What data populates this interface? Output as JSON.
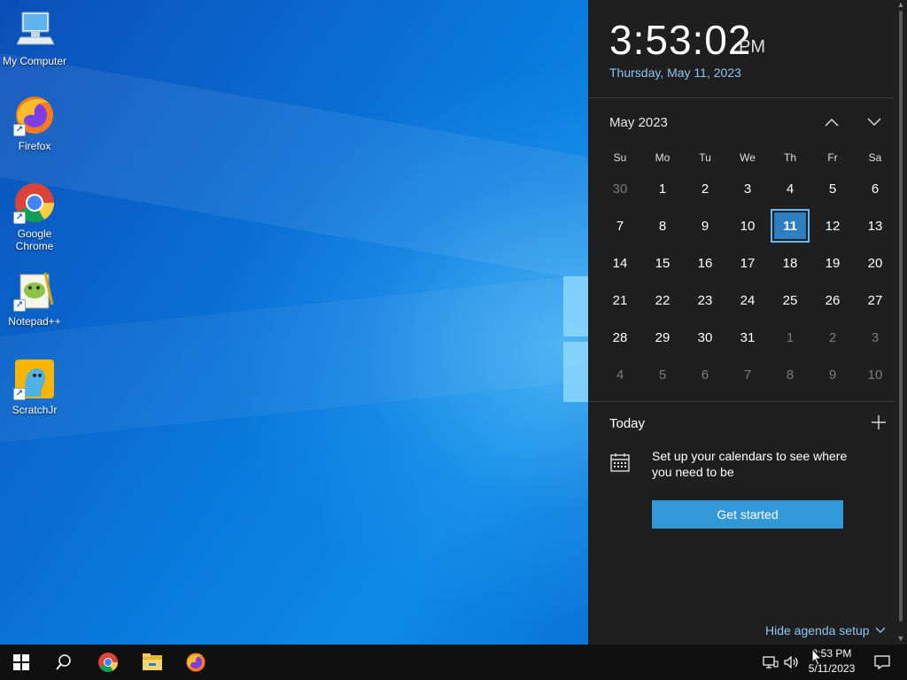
{
  "desktop": {
    "icons": [
      {
        "label": "My Computer",
        "icon": "computer-icon"
      },
      {
        "label": "Firefox",
        "icon": "firefox-icon"
      },
      {
        "label": "Google Chrome",
        "icon": "chrome-icon"
      },
      {
        "label": "Notepad++",
        "icon": "notepadpp-icon"
      },
      {
        "label": "ScratchJr",
        "icon": "scratchjr-icon"
      }
    ]
  },
  "flyout": {
    "time": "3:53:02",
    "ampm": "PM",
    "date": "Thursday, May 11, 2023",
    "month_label": "May 2023",
    "weekdays": [
      "Su",
      "Mo",
      "Tu",
      "We",
      "Th",
      "Fr",
      "Sa"
    ],
    "weeks": [
      [
        "30",
        "1",
        "2",
        "3",
        "4",
        "5",
        "6"
      ],
      [
        "7",
        "8",
        "9",
        "10",
        "11",
        "12",
        "13"
      ],
      [
        "14",
        "15",
        "16",
        "17",
        "18",
        "19",
        "20"
      ],
      [
        "21",
        "22",
        "23",
        "24",
        "25",
        "26",
        "27"
      ],
      [
        "28",
        "29",
        "30",
        "31",
        "1",
        "2",
        "3"
      ],
      [
        "4",
        "5",
        "6",
        "7",
        "8",
        "9",
        "10"
      ]
    ],
    "today_label": "Today",
    "agenda_message": "Set up your calendars to see where you need to be",
    "get_started_label": "Get started",
    "hide_agenda_label": "Hide agenda setup"
  },
  "taskbar": {
    "pinned": [
      "start-icon",
      "search-icon",
      "chrome-icon",
      "file-explorer-icon",
      "firefox-icon"
    ],
    "tray": [
      "network-icon",
      "volume-icon"
    ],
    "clock_time": "3:53 PM",
    "clock_date": "5/11/2023"
  },
  "colors": {
    "flyout_bg": "#1f1f1f",
    "accent": "#3399d6",
    "link": "#8fc4f5",
    "taskbar_bg": "#101010"
  }
}
